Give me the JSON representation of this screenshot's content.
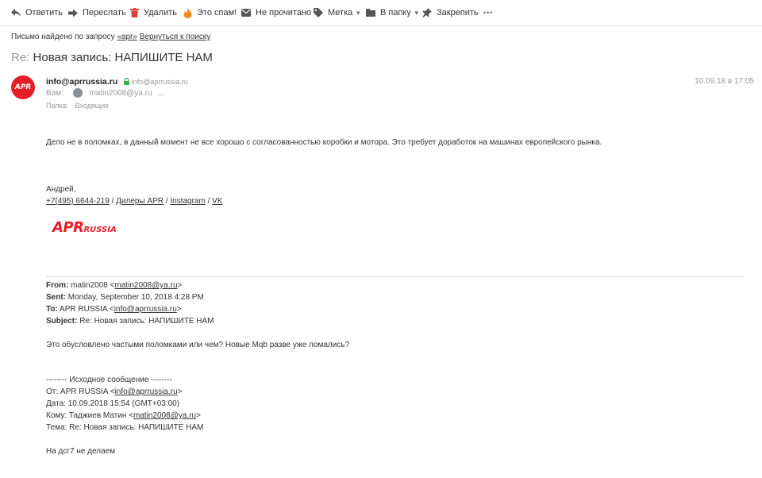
{
  "toolbar": {
    "reply": "Ответить",
    "forward": "Переслать",
    "delete": "Удалить",
    "spam": "Это спам!",
    "unread": "Не прочитано",
    "label": "Метка",
    "folder": "В папку",
    "pin": "Закрепить",
    "more": "•••"
  },
  "search": {
    "found_prefix": "Письмо найдено по запросу",
    "query": "«apr»",
    "back": "Вернуться к поиску"
  },
  "message": {
    "subject_prefix": "Re:",
    "subject": "Новая запись: НАПИШИТЕ НАМ",
    "sender_name": "info@aprrussia.ru",
    "sender_verified": "info@aprrussia.ru",
    "to_label": "Вам:",
    "to_address": "matin2008@ya.ru",
    "folder_label": "Папка:",
    "folder_value": "Входящие",
    "date": "10.09.18 в 17:05",
    "avatar_text": "APR"
  },
  "body": {
    "text1": "Дело не в поломках, в данный момент не все хорошо с согласованностью коробки и мотора. Это требует доработок на машинах европейского рынка.",
    "sign_name": "Андрей,",
    "phone": "+7(495) 6644-219",
    "sep": " / ",
    "link_dealers": "Дилеры APR",
    "link_instagram": "Instagram",
    "link_vk": "VK",
    "logo_main": "APR",
    "logo_sub": "RUSSIA"
  },
  "quote": {
    "from_label": "From:",
    "from_value": "matin2008 <",
    "from_email": "matin2008@ya.ru",
    "close": ">",
    "sent_label": "Sent:",
    "sent_value": "Monday, September 10, 2018 4:28 PM",
    "to_label": "To:",
    "to_value": "APR RUSSIA <",
    "to_email": "info@aprrussia.ru",
    "subject_label": "Subject:",
    "subject_value": "Re: Новая запись: НАПИШИТЕ НАМ",
    "text": "Это обусловлено частыми поломками или чем? Новые Mqb разве уже ломались?",
    "orig_header": "-------- Исходное сообщение --------",
    "orig_from": "От: APR RUSSIA <",
    "orig_from_email": "info@aprrussia.ru",
    "orig_date": "Дата: 10.09.2018 15:54 (GMT+03:00)",
    "orig_to": "Кому: Таджиев Матин <",
    "orig_to_email": "matin2008@ya.ru",
    "orig_subject": "Тема: Re: Новая запись: НАПИШИТЕ НАМ",
    "last_line": "На дсг7 не делаем"
  },
  "colors": {
    "accent": "#e41e26",
    "verified": "#2fb24c",
    "spam": "#f08a24",
    "delete": "#e23c3c"
  }
}
